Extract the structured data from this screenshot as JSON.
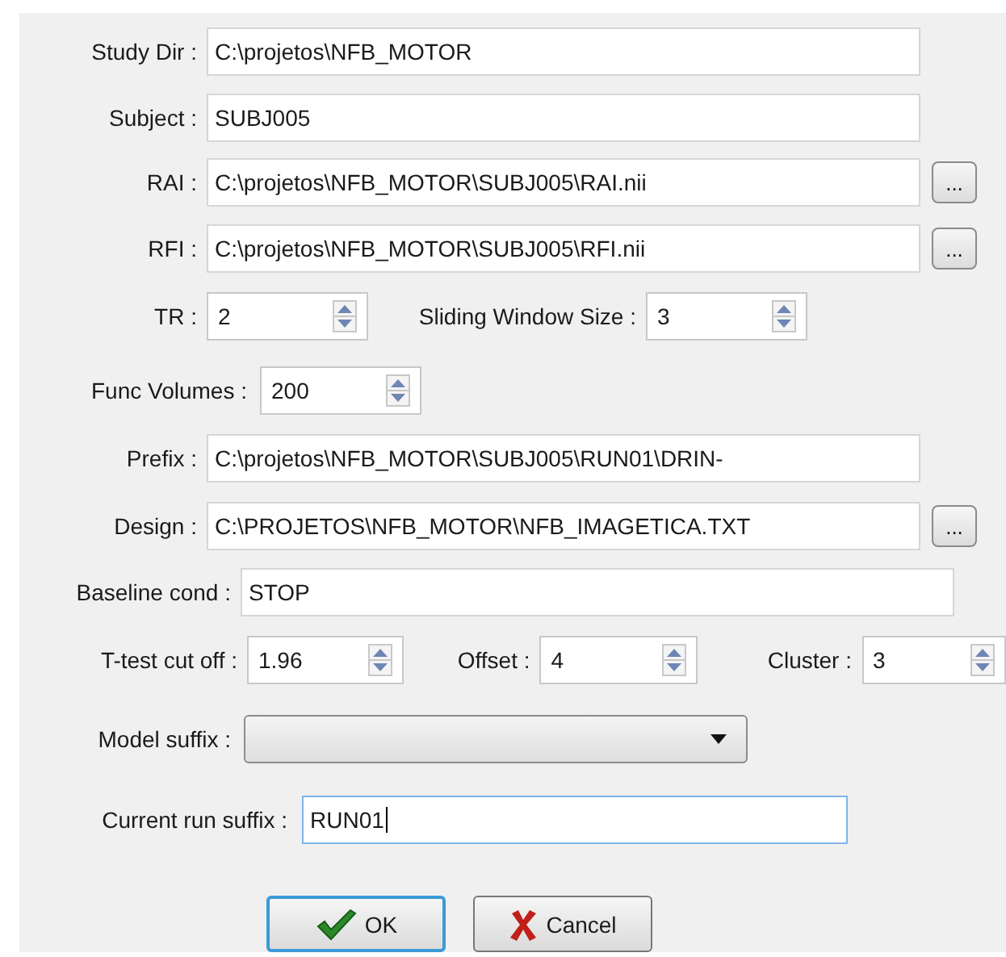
{
  "rows": [
    {
      "items": [
        {
          "kind": "label",
          "text": "Study Dir :"
        },
        {
          "kind": "text",
          "value": "C:\\projetos\\NFB_MOTOR",
          "focused": false
        }
      ]
    },
    {
      "items": [
        {
          "kind": "label",
          "text": "Subject :"
        },
        {
          "kind": "text",
          "value": "SUBJ005",
          "focused": false
        }
      ]
    },
    {
      "items": [
        {
          "kind": "label",
          "text": "RAI :"
        },
        {
          "kind": "text",
          "value": "C:\\projetos\\NFB_MOTOR\\SUBJ005\\RAI.nii",
          "focused": false
        },
        {
          "kind": "browse",
          "text": "..."
        }
      ]
    },
    {
      "items": [
        {
          "kind": "label",
          "text": "RFI :"
        },
        {
          "kind": "text",
          "value": "C:\\projetos\\NFB_MOTOR\\SUBJ005\\RFI.nii",
          "focused": false
        },
        {
          "kind": "browse",
          "text": "..."
        }
      ]
    },
    {
      "items": [
        {
          "kind": "label",
          "text": "TR :"
        },
        {
          "kind": "spin",
          "value": "2"
        },
        {
          "kind": "label",
          "text": "Sliding Window Size :"
        },
        {
          "kind": "spin",
          "value": "3"
        }
      ]
    },
    {
      "items": [
        {
          "kind": "label",
          "text": "Func Volumes :"
        },
        {
          "kind": "spin",
          "value": "200"
        }
      ]
    },
    {
      "items": [
        {
          "kind": "label",
          "text": "Prefix :"
        },
        {
          "kind": "text",
          "value": "C:\\projetos\\NFB_MOTOR\\SUBJ005\\RUN01\\DRIN-",
          "focused": false
        }
      ]
    },
    {
      "items": [
        {
          "kind": "label",
          "text": "Design :"
        },
        {
          "kind": "text",
          "value": "C:\\PROJETOS\\NFB_MOTOR\\NFB_IMAGETICA.TXT",
          "focused": false
        },
        {
          "kind": "browse",
          "text": "..."
        }
      ]
    },
    {
      "items": [
        {
          "kind": "label",
          "text": "Baseline cond :"
        },
        {
          "kind": "text",
          "value": "STOP",
          "focused": false
        }
      ]
    },
    {
      "items": [
        {
          "kind": "label",
          "text": "T-test cut off :"
        },
        {
          "kind": "spin",
          "value": "1.96"
        },
        {
          "kind": "label",
          "text": "Offset :"
        },
        {
          "kind": "spin",
          "value": "4"
        },
        {
          "kind": "label",
          "text": "Cluster :"
        },
        {
          "kind": "spin",
          "value": "3"
        }
      ]
    },
    {
      "items": [
        {
          "kind": "label",
          "text": "Model suffix :"
        },
        {
          "kind": "combo"
        }
      ]
    },
    {
      "items": [
        {
          "kind": "label",
          "text": "Current run suffix :"
        },
        {
          "kind": "text",
          "value": "RUN01",
          "focused": true
        }
      ]
    }
  ],
  "buttons": [
    {
      "kind": "ok",
      "label": "OK",
      "focused": true
    },
    {
      "kind": "cancel",
      "label": "Cancel",
      "focused": false
    }
  ]
}
